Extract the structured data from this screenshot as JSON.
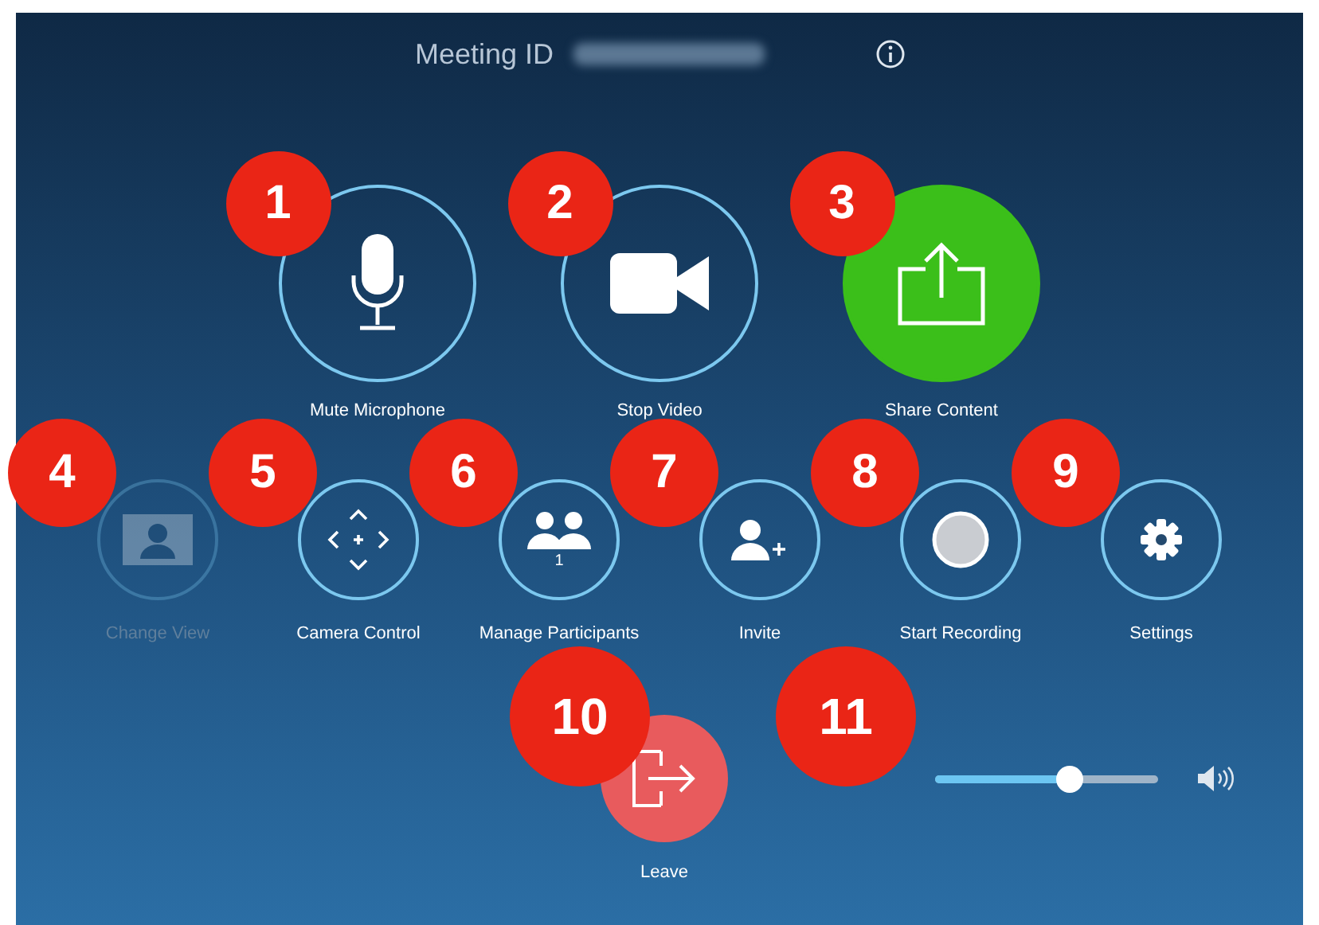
{
  "header": {
    "label": "Meeting ID"
  },
  "primary_buttons": [
    {
      "label": "Mute Microphone",
      "kind": "microphone",
      "highlighted": false,
      "callout": "1"
    },
    {
      "label": "Stop Video",
      "kind": "video",
      "highlighted": false,
      "callout": "2"
    },
    {
      "label": "Share Content",
      "kind": "share",
      "highlighted": true,
      "callout": "3"
    }
  ],
  "secondary_buttons": [
    {
      "label": "Change View",
      "kind": "view",
      "disabled": true,
      "callout": "4"
    },
    {
      "label": "Camera Control",
      "kind": "camera",
      "disabled": false,
      "callout": "5"
    },
    {
      "label": "Manage Participants",
      "kind": "participants",
      "disabled": false,
      "count": "1",
      "callout": "6"
    },
    {
      "label": "Invite",
      "kind": "invite",
      "disabled": false,
      "callout": "7"
    },
    {
      "label": "Start Recording",
      "kind": "record",
      "disabled": false,
      "callout": "8"
    },
    {
      "label": "Settings",
      "kind": "settings",
      "disabled": false,
      "callout": "9"
    }
  ],
  "leave": {
    "label": "Leave",
    "callout": "10"
  },
  "volume": {
    "level": 0.6,
    "callout": "11"
  }
}
